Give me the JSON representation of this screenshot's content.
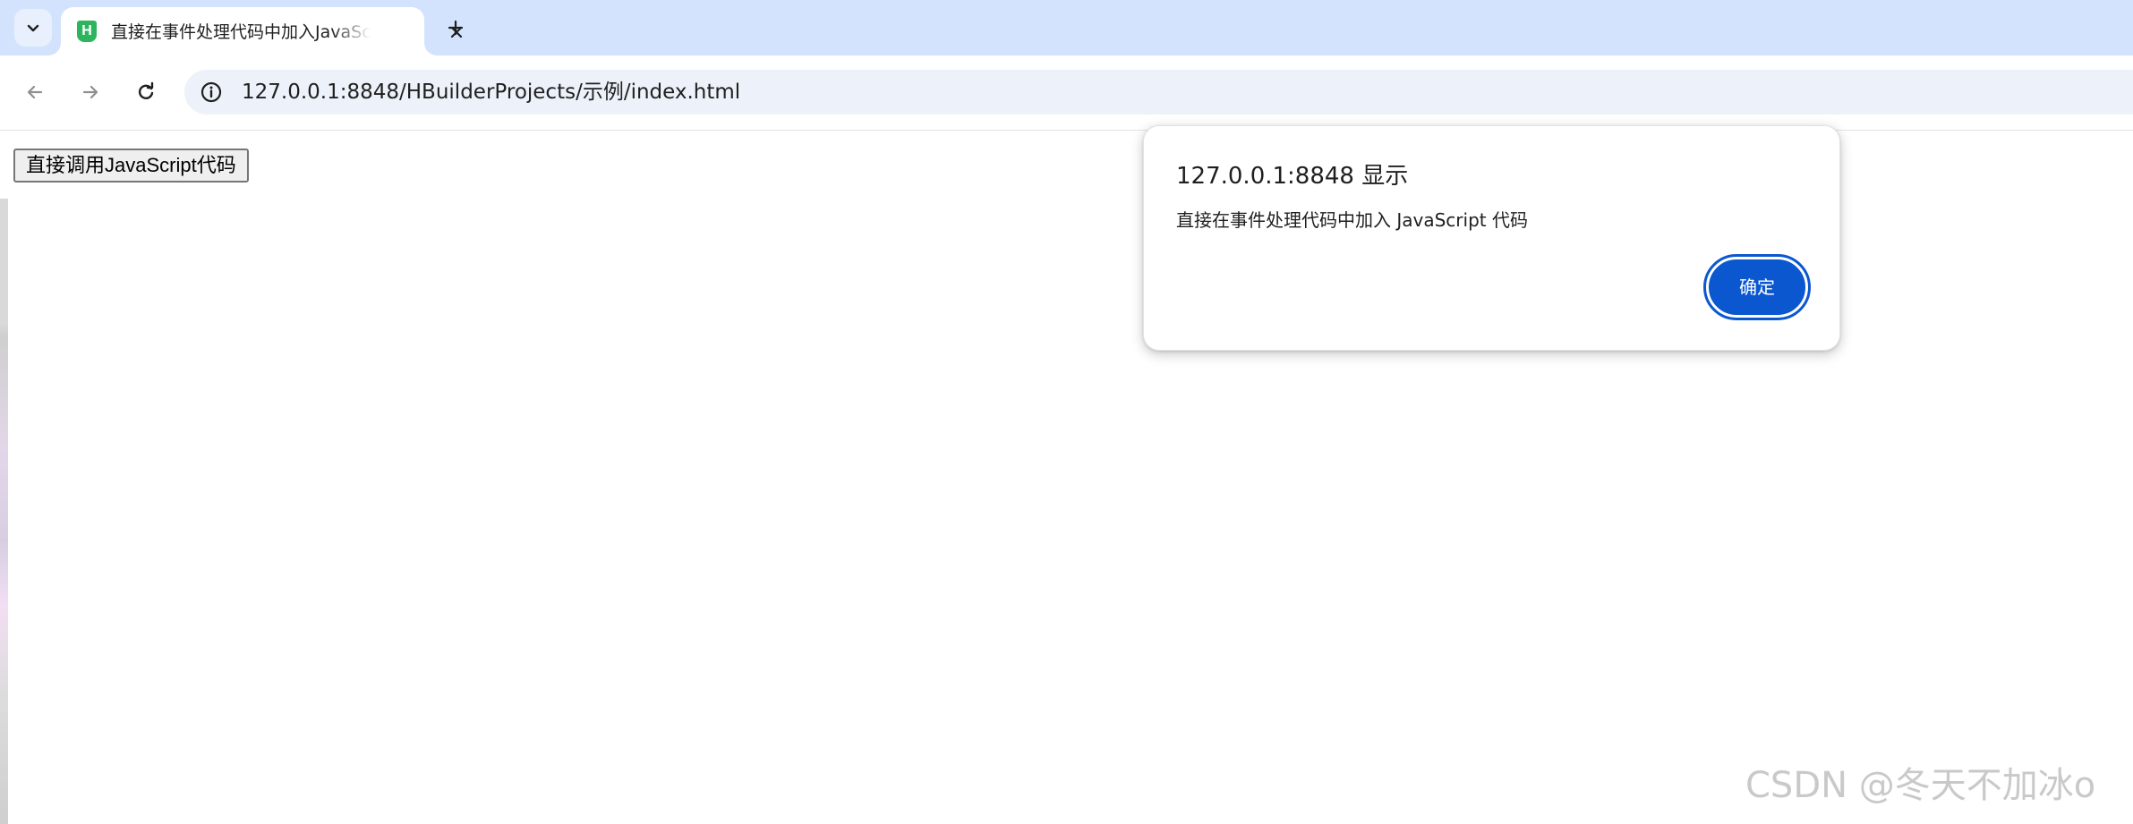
{
  "browser": {
    "tab": {
      "favicon_letter": "H",
      "title": "直接在事件处理代码中加入JavaScript代码",
      "favicon_color": "#2db55d"
    },
    "address_bar": {
      "url": "127.0.0.1:8848/HBuilderProjects/示例/index.html"
    },
    "icons": {
      "tab_search": "chevron-down-icon",
      "tab_close": "close-icon",
      "new_tab": "plus-icon",
      "back": "arrow-left-icon",
      "forward": "arrow-right-icon",
      "reload": "reload-icon",
      "site_info": "info-icon"
    }
  },
  "page": {
    "button_label": "直接调用JavaScript代码"
  },
  "alert": {
    "title": "127.0.0.1:8848 显示",
    "message": "直接在事件处理代码中加入 JavaScript 代码",
    "ok_label": "确定",
    "accent_color": "#0b57d0"
  },
  "watermark": {
    "text": "CSDN @冬天不加冰o"
  }
}
